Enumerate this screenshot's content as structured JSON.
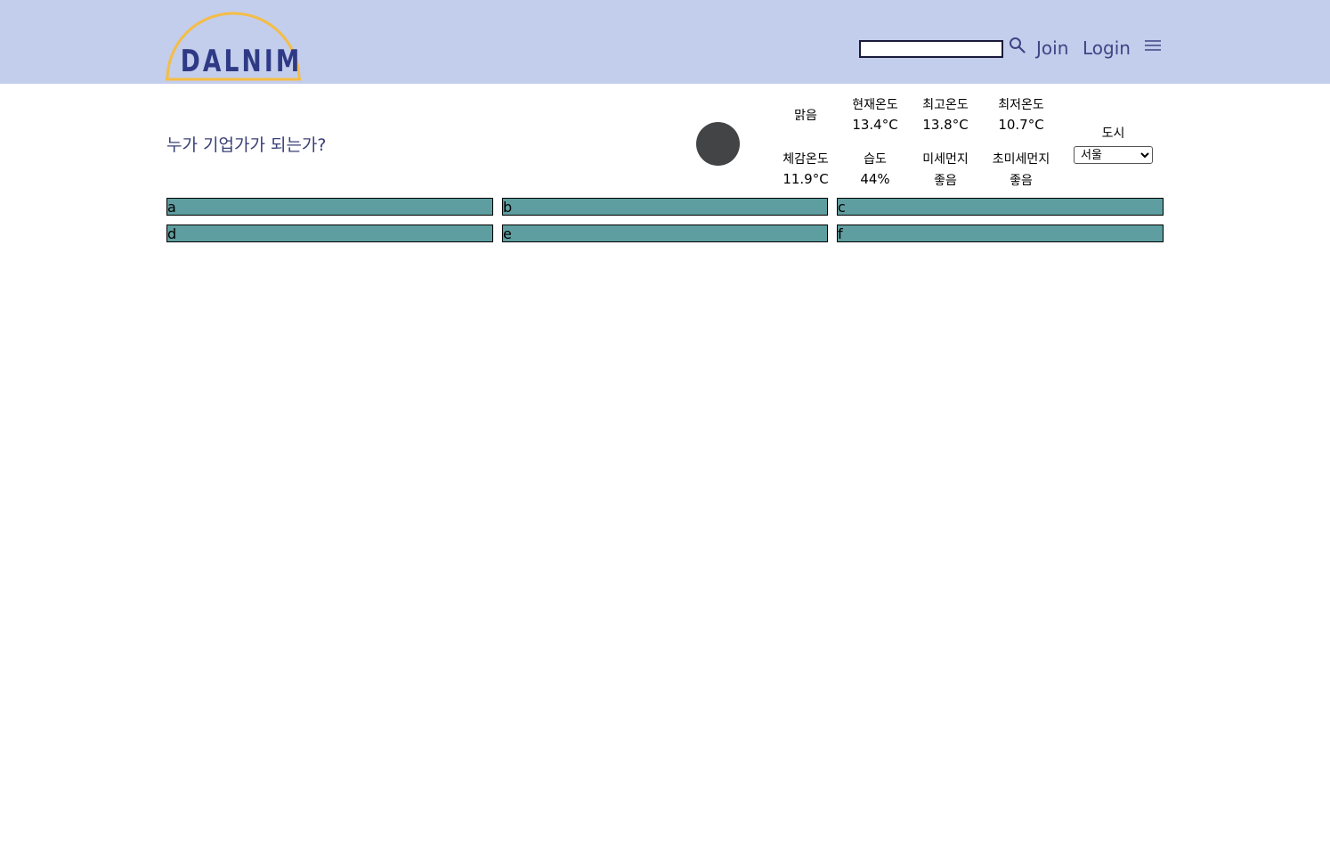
{
  "header": {
    "logo_text": "DALNIM",
    "search": {
      "value": "",
      "placeholder": ""
    },
    "join_label": "Join",
    "login_label": "Login",
    "icons": {
      "search": "search-icon",
      "menu": "hamburger-menu-icon"
    },
    "background_color": "#c3cdec",
    "logo_arc_color": "#f4bd45",
    "logo_text_color": "#2f3a86"
  },
  "main": {
    "title": "누가 기업가가 되는가?",
    "weather_icon_color": "#434446"
  },
  "weather": {
    "condition": "맑음",
    "current_temp": {
      "label": "현재온도",
      "value": "13.4°C"
    },
    "max_temp": {
      "label": "최고온도",
      "value": "13.8°C"
    },
    "min_temp": {
      "label": "최저온도",
      "value": "10.7°C"
    },
    "feels_like": {
      "label": "체감온도",
      "value": "11.9°C"
    },
    "humidity": {
      "label": "습도",
      "value": "44%"
    },
    "fine_dust": {
      "label": "미세먼지",
      "value": "좋음"
    },
    "ultra_fine_dust": {
      "label": "초미세먼지",
      "value": "좋음"
    }
  },
  "city": {
    "label": "도시",
    "selected": "서울"
  },
  "grid": {
    "box_color": "#5f9ea0",
    "items": [
      "a",
      "b",
      "c",
      "d",
      "e",
      "f"
    ]
  }
}
